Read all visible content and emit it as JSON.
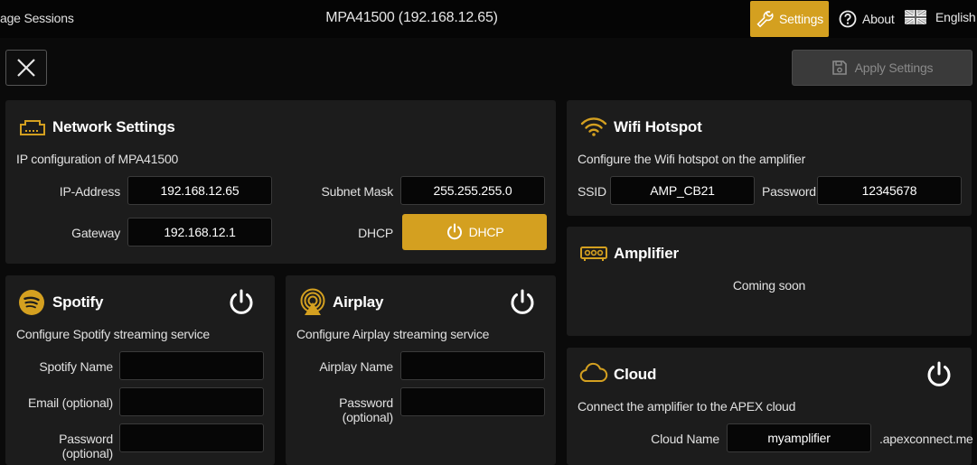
{
  "topbar": {
    "left_label": "age Sessions",
    "title": "MPA41500 (192.168.12.65)",
    "settings_label": "Settings",
    "about_label": "About",
    "language_label": "English"
  },
  "toolbar": {
    "apply_label": "Apply Settings"
  },
  "network": {
    "title": "Network Settings",
    "description": "IP configuration of MPA41500",
    "ip_label": "IP-Address",
    "ip_value": "192.168.12.65",
    "subnet_label": "Subnet Mask",
    "subnet_value": "255.255.255.0",
    "gateway_label": "Gateway",
    "gateway_value": "192.168.12.1",
    "dhcp_label": "DHCP",
    "dhcp_button": "DHCP"
  },
  "wifi": {
    "title": "Wifi Hotspot",
    "description": "Configure the Wifi hotspot on the amplifier",
    "ssid_label": "SSID",
    "ssid_value": "AMP_CB21",
    "password_label": "Password",
    "password_value": "12345678"
  },
  "amplifier": {
    "title": "Amplifier",
    "status": "Coming soon"
  },
  "spotify": {
    "title": "Spotify",
    "description": "Configure Spotify streaming service",
    "name_label": "Spotify Name",
    "email_label": "Email (optional)",
    "password_label": "Password (optional)"
  },
  "airplay": {
    "title": "Airplay",
    "description": "Configure Airplay streaming service",
    "name_label": "Airplay Name",
    "password_label": "Password (optional)"
  },
  "cloud": {
    "title": "Cloud",
    "description": "Connect the amplifier to the APEX cloud",
    "name_label": "Cloud Name",
    "name_value": "myamplifier",
    "domain_suffix": ".apexconnect.me"
  },
  "colors": {
    "accent": "#d4a020",
    "background": "#0a0a0a",
    "card": "#1c1c1c",
    "input": "#060606"
  },
  "icons": [
    "wrench-icon",
    "help-circle-icon",
    "uk-flag-icon",
    "close-icon",
    "save-icon",
    "ethernet-port-icon",
    "wifi-icon",
    "power-icon",
    "amplifier-icon",
    "spotify-icon",
    "airplay-icon",
    "cloud-icon"
  ]
}
